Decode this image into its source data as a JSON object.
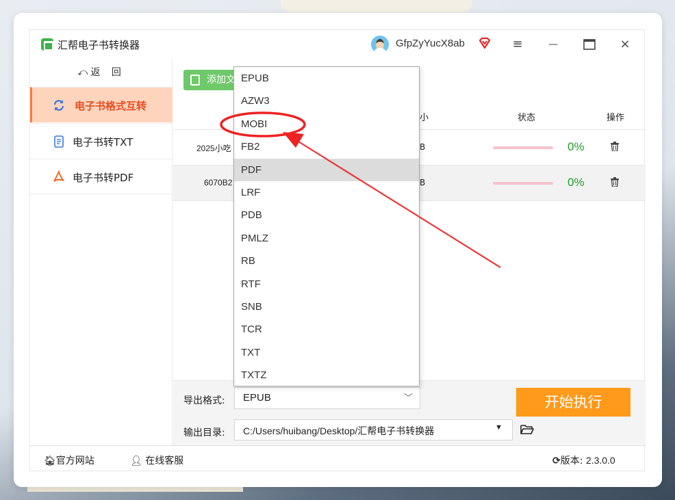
{
  "app": {
    "title": "汇帮电子书转换器",
    "username": "GfpZyYucX8ab",
    "colors": {
      "accent": "#ff9a1a",
      "active_nav_bg": "#ffd4bd",
      "active_nav_text": "#e84c20",
      "add_button": "#6fc86a",
      "progress_text": "#1e9e2a",
      "annotation": "#ee3333"
    }
  },
  "window_controls": {
    "menu_icon": "≡",
    "minimize_icon": "—",
    "maximize_icon": "▭",
    "close_icon": "×"
  },
  "sidebar": {
    "back_label": "返 回",
    "items": [
      {
        "label": "电子书格式互转",
        "icon": "refresh-icon",
        "active": true
      },
      {
        "label": "电子书转TXT",
        "icon": "document-icon",
        "active": false
      },
      {
        "label": "电子书转PDF",
        "icon": "pdf-icon",
        "active": false
      }
    ]
  },
  "main": {
    "add_button_label": "添加文",
    "columns": {
      "size": "小",
      "status": "状态",
      "actions": "操作"
    },
    "rows": [
      {
        "name": "2025小吃",
        "size": "B",
        "progress_text": "0%",
        "progress": 0
      },
      {
        "name": "6070B2",
        "size": "B",
        "progress_text": "0%",
        "progress": 0
      }
    ]
  },
  "export": {
    "format_label": "导出格式:",
    "format_value": "EPUB",
    "dir_label": "输出目录:",
    "dir_value": "C:/Users/huibang/Desktop/汇帮电子书转换器",
    "start_button": "开始执行"
  },
  "format_dropdown": {
    "options": [
      "EPUB",
      "AZW3",
      "MOBI",
      "FB2",
      "PDF",
      "LRF",
      "PDB",
      "PMLZ",
      "RB",
      "RTF",
      "SNB",
      "TCR",
      "TXT",
      "TXTZ"
    ],
    "hovered": "PDF",
    "highlighted": "MOBI"
  },
  "statusbar": {
    "website_label": "官方网站",
    "support_label": "在线客服",
    "version_label": "版本:",
    "version_value": "2.3.0.0"
  }
}
